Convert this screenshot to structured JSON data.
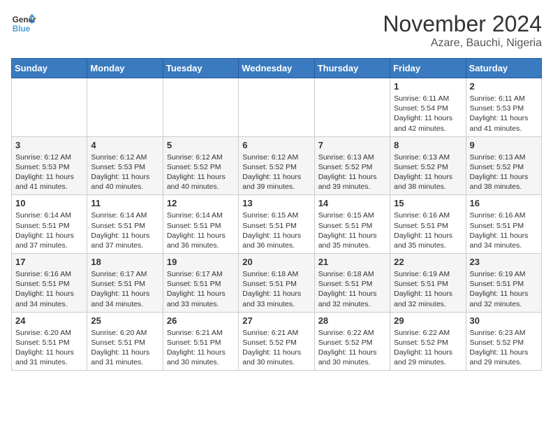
{
  "logo": {
    "line1": "General",
    "line2": "Blue"
  },
  "title": "November 2024",
  "location": "Azare, Bauchi, Nigeria",
  "days_of_week": [
    "Sunday",
    "Monday",
    "Tuesday",
    "Wednesday",
    "Thursday",
    "Friday",
    "Saturday"
  ],
  "weeks": [
    [
      {
        "day": "",
        "info": ""
      },
      {
        "day": "",
        "info": ""
      },
      {
        "day": "",
        "info": ""
      },
      {
        "day": "",
        "info": ""
      },
      {
        "day": "",
        "info": ""
      },
      {
        "day": "1",
        "info": "Sunrise: 6:11 AM\nSunset: 5:54 PM\nDaylight: 11 hours\nand 42 minutes."
      },
      {
        "day": "2",
        "info": "Sunrise: 6:11 AM\nSunset: 5:53 PM\nDaylight: 11 hours\nand 41 minutes."
      }
    ],
    [
      {
        "day": "3",
        "info": "Sunrise: 6:12 AM\nSunset: 5:53 PM\nDaylight: 11 hours\nand 41 minutes."
      },
      {
        "day": "4",
        "info": "Sunrise: 6:12 AM\nSunset: 5:53 PM\nDaylight: 11 hours\nand 40 minutes."
      },
      {
        "day": "5",
        "info": "Sunrise: 6:12 AM\nSunset: 5:52 PM\nDaylight: 11 hours\nand 40 minutes."
      },
      {
        "day": "6",
        "info": "Sunrise: 6:12 AM\nSunset: 5:52 PM\nDaylight: 11 hours\nand 39 minutes."
      },
      {
        "day": "7",
        "info": "Sunrise: 6:13 AM\nSunset: 5:52 PM\nDaylight: 11 hours\nand 39 minutes."
      },
      {
        "day": "8",
        "info": "Sunrise: 6:13 AM\nSunset: 5:52 PM\nDaylight: 11 hours\nand 38 minutes."
      },
      {
        "day": "9",
        "info": "Sunrise: 6:13 AM\nSunset: 5:52 PM\nDaylight: 11 hours\nand 38 minutes."
      }
    ],
    [
      {
        "day": "10",
        "info": "Sunrise: 6:14 AM\nSunset: 5:51 PM\nDaylight: 11 hours\nand 37 minutes."
      },
      {
        "day": "11",
        "info": "Sunrise: 6:14 AM\nSunset: 5:51 PM\nDaylight: 11 hours\nand 37 minutes."
      },
      {
        "day": "12",
        "info": "Sunrise: 6:14 AM\nSunset: 5:51 PM\nDaylight: 11 hours\nand 36 minutes."
      },
      {
        "day": "13",
        "info": "Sunrise: 6:15 AM\nSunset: 5:51 PM\nDaylight: 11 hours\nand 36 minutes."
      },
      {
        "day": "14",
        "info": "Sunrise: 6:15 AM\nSunset: 5:51 PM\nDaylight: 11 hours\nand 35 minutes."
      },
      {
        "day": "15",
        "info": "Sunrise: 6:16 AM\nSunset: 5:51 PM\nDaylight: 11 hours\nand 35 minutes."
      },
      {
        "day": "16",
        "info": "Sunrise: 6:16 AM\nSunset: 5:51 PM\nDaylight: 11 hours\nand 34 minutes."
      }
    ],
    [
      {
        "day": "17",
        "info": "Sunrise: 6:16 AM\nSunset: 5:51 PM\nDaylight: 11 hours\nand 34 minutes."
      },
      {
        "day": "18",
        "info": "Sunrise: 6:17 AM\nSunset: 5:51 PM\nDaylight: 11 hours\nand 34 minutes."
      },
      {
        "day": "19",
        "info": "Sunrise: 6:17 AM\nSunset: 5:51 PM\nDaylight: 11 hours\nand 33 minutes."
      },
      {
        "day": "20",
        "info": "Sunrise: 6:18 AM\nSunset: 5:51 PM\nDaylight: 11 hours\nand 33 minutes."
      },
      {
        "day": "21",
        "info": "Sunrise: 6:18 AM\nSunset: 5:51 PM\nDaylight: 11 hours\nand 32 minutes."
      },
      {
        "day": "22",
        "info": "Sunrise: 6:19 AM\nSunset: 5:51 PM\nDaylight: 11 hours\nand 32 minutes."
      },
      {
        "day": "23",
        "info": "Sunrise: 6:19 AM\nSunset: 5:51 PM\nDaylight: 11 hours\nand 32 minutes."
      }
    ],
    [
      {
        "day": "24",
        "info": "Sunrise: 6:20 AM\nSunset: 5:51 PM\nDaylight: 11 hours\nand 31 minutes."
      },
      {
        "day": "25",
        "info": "Sunrise: 6:20 AM\nSunset: 5:51 PM\nDaylight: 11 hours\nand 31 minutes."
      },
      {
        "day": "26",
        "info": "Sunrise: 6:21 AM\nSunset: 5:51 PM\nDaylight: 11 hours\nand 30 minutes."
      },
      {
        "day": "27",
        "info": "Sunrise: 6:21 AM\nSunset: 5:52 PM\nDaylight: 11 hours\nand 30 minutes."
      },
      {
        "day": "28",
        "info": "Sunrise: 6:22 AM\nSunset: 5:52 PM\nDaylight: 11 hours\nand 30 minutes."
      },
      {
        "day": "29",
        "info": "Sunrise: 6:22 AM\nSunset: 5:52 PM\nDaylight: 11 hours\nand 29 minutes."
      },
      {
        "day": "30",
        "info": "Sunrise: 6:23 AM\nSunset: 5:52 PM\nDaylight: 11 hours\nand 29 minutes."
      }
    ]
  ]
}
